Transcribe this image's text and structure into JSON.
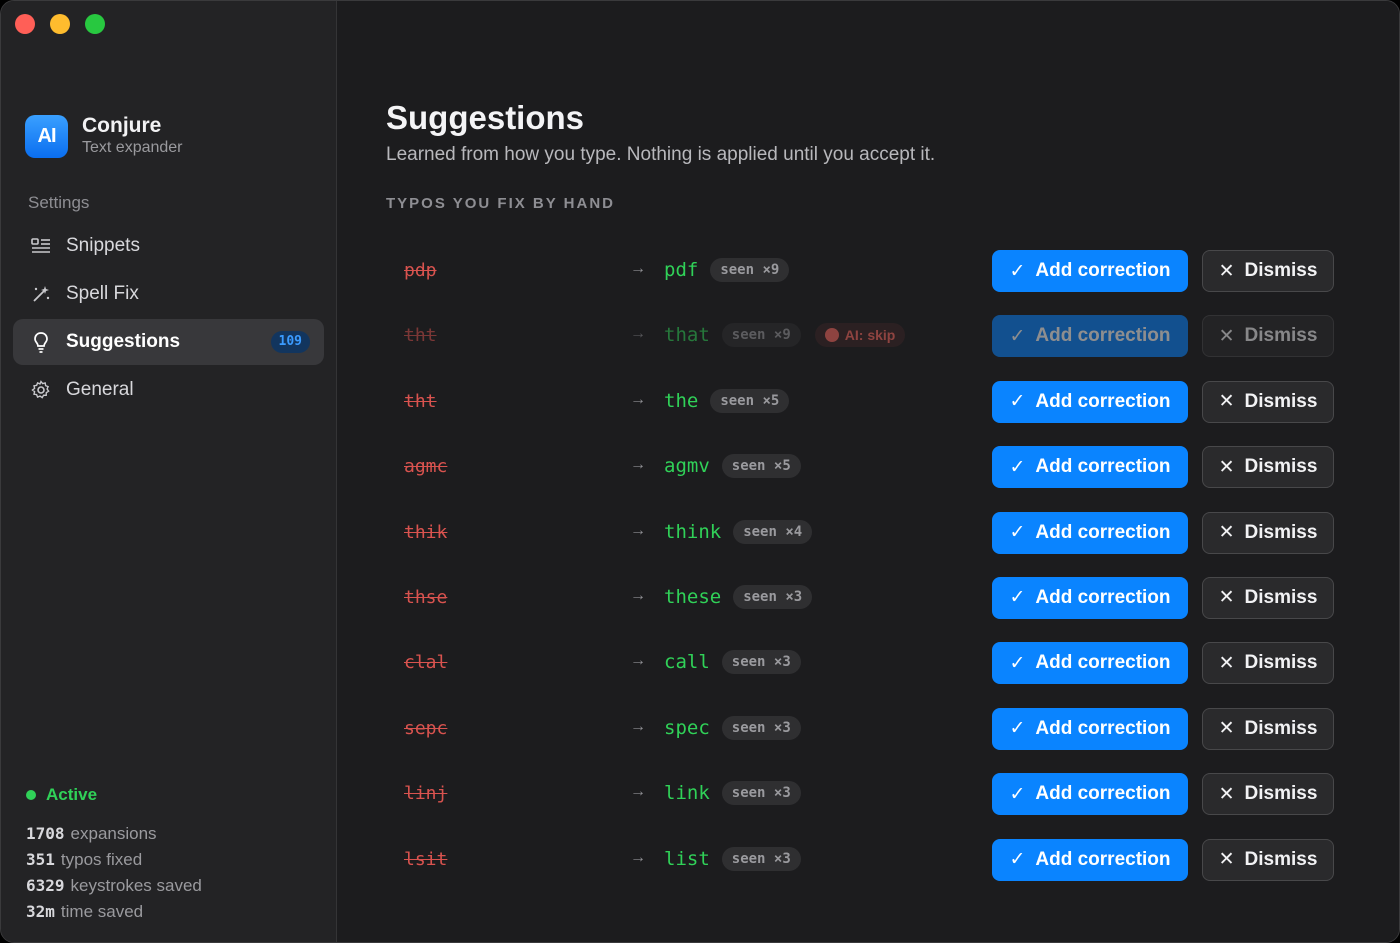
{
  "app": {
    "name": "Conjure",
    "subtitle": "Text expander",
    "icon_text": "AΙ"
  },
  "sidebar": {
    "settings_label": "Settings",
    "items": [
      {
        "label": "Snippets",
        "icon": "snippets-icon"
      },
      {
        "label": "Spell Fix",
        "icon": "wand-icon"
      },
      {
        "label": "Suggestions",
        "icon": "lightbulb-icon",
        "badge": "109",
        "active": true
      },
      {
        "label": "General",
        "icon": "gear-icon"
      }
    ],
    "status": "Active",
    "stats": [
      {
        "value": "1708",
        "label": "expansions"
      },
      {
        "value": "351",
        "label": "typos fixed"
      },
      {
        "value": "6329",
        "label": "keystrokes saved"
      },
      {
        "value": "32m",
        "label": "time saved"
      }
    ]
  },
  "main": {
    "title": "Suggestions",
    "subtitle": "Learned from how you type. Nothing is applied until you accept it.",
    "section_label": "TYPOS YOU FIX BY HAND",
    "add_label": "Add correction",
    "dismiss_label": "Dismiss",
    "ai_skip_label": "AI: skip",
    "rows": [
      {
        "typo": "pdp",
        "fix": "pdf",
        "seen": "seen ×9"
      },
      {
        "typo": "tht",
        "fix": "that",
        "seen": "seen ×9",
        "ai_skip": true,
        "dim": true
      },
      {
        "typo": "tht",
        "fix": "the",
        "seen": "seen ×5"
      },
      {
        "typo": "agmc",
        "fix": "agmv",
        "seen": "seen ×5"
      },
      {
        "typo": "thik",
        "fix": "think",
        "seen": "seen ×4"
      },
      {
        "typo": "thse",
        "fix": "these",
        "seen": "seen ×3"
      },
      {
        "typo": "clal",
        "fix": "call",
        "seen": "seen ×3"
      },
      {
        "typo": "sepc",
        "fix": "spec",
        "seen": "seen ×3"
      },
      {
        "typo": "linj",
        "fix": "link",
        "seen": "seen ×3"
      },
      {
        "typo": "lsit",
        "fix": "list",
        "seen": "seen ×3"
      }
    ]
  },
  "colors": {
    "accent": "#0a84ff",
    "typo": "#d9534f",
    "fix": "#30d158",
    "active": "#30d158"
  }
}
